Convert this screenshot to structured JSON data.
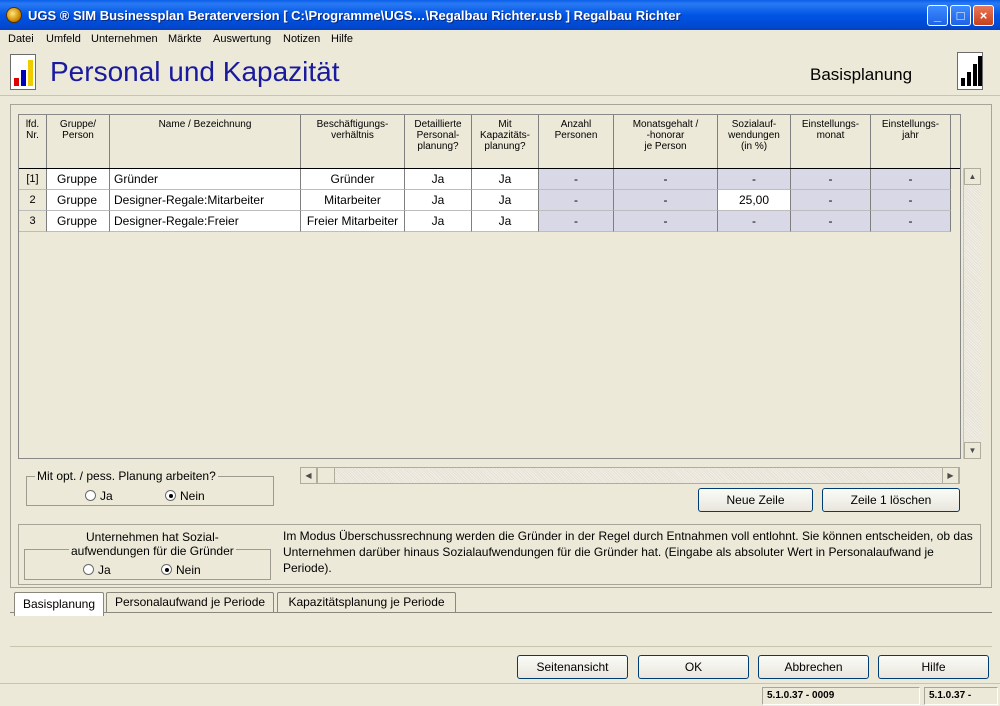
{
  "window": {
    "title": "UGS ® SIM Businessplan Beraterversion   [ C:\\Programme\\UGS…\\Regalbau Richter.usb ] Regalbau Richter",
    "minimize": "_",
    "maximize": "□",
    "close": "×"
  },
  "menu": [
    "Datei",
    "Umfeld",
    "Unternehmen",
    "Märkte",
    "Auswertung",
    "Notizen",
    "Hilfe"
  ],
  "header": {
    "title": "Personal und Kapazität",
    "section": "Basisplanung"
  },
  "table": {
    "columns": [
      "lfd.\nNr.",
      "Gruppe/\nPerson",
      "Name / Bezeichnung",
      "Beschäftigungs-\nverhältnis",
      "Detaillierte\nPersonal-\nplanung?",
      "Mit\nKapazitäts-\nplanung?",
      "Anzahl\nPersonen",
      "Monatsgehalt /\n-honorar\nje Person",
      "Sozialauf-\nwendungen\n(in %)",
      "Einstellungs-\nmonat",
      "Einstellungs-\njahr"
    ],
    "rows": [
      [
        "[1]",
        "Gruppe",
        "Gründer",
        "Gründer",
        "Ja",
        "Ja",
        "-",
        "-",
        "-",
        "-",
        "-"
      ],
      [
        "2",
        "Gruppe",
        "Designer-Regale:Mitarbeiter",
        "Mitarbeiter",
        "Ja",
        "Ja",
        "-",
        "-",
        "25,00",
        "-",
        "-"
      ],
      [
        "3",
        "Gruppe",
        "Designer-Regale:Freier",
        "Freier Mitarbeiter",
        "Ja",
        "Ja",
        "-",
        "-",
        "-",
        "-",
        "-"
      ]
    ]
  },
  "opt_planning": {
    "legend": "Mit opt. / pess. Planung arbeiten?",
    "options": [
      "Ja",
      "Nein"
    ],
    "selected": "Nein"
  },
  "social_expenses": {
    "legend_line1": "Unternehmen hat Sozial-",
    "legend_line2": "aufwendungen für die Gründer",
    "options": [
      "Ja",
      "Nein"
    ],
    "selected": "Nein"
  },
  "buttons": {
    "new_row": "Neue Zeile",
    "delete_row": "Zeile 1 löschen",
    "page_view": "Seitenansicht",
    "ok": "OK",
    "cancel": "Abbrechen",
    "help": "Hilfe"
  },
  "info_text": "Im Modus Überschussrechnung  werden die Gründer in der Regel durch Entnahmen voll entlohnt. Sie können entscheiden, ob das Unternehmen darüber hinaus Sozialaufwendungen für die Gründer hat. (Eingabe als absoluter Wert in Personalaufwand je Periode).",
  "tabs": [
    "Basisplanung",
    "Personalaufwand je Periode",
    "Kapazitätsplanung je Periode"
  ],
  "active_tab": "Basisplanung",
  "status": {
    "version1": "5.1.0.37 - 0009",
    "version2": "5.1.0.37 -"
  }
}
